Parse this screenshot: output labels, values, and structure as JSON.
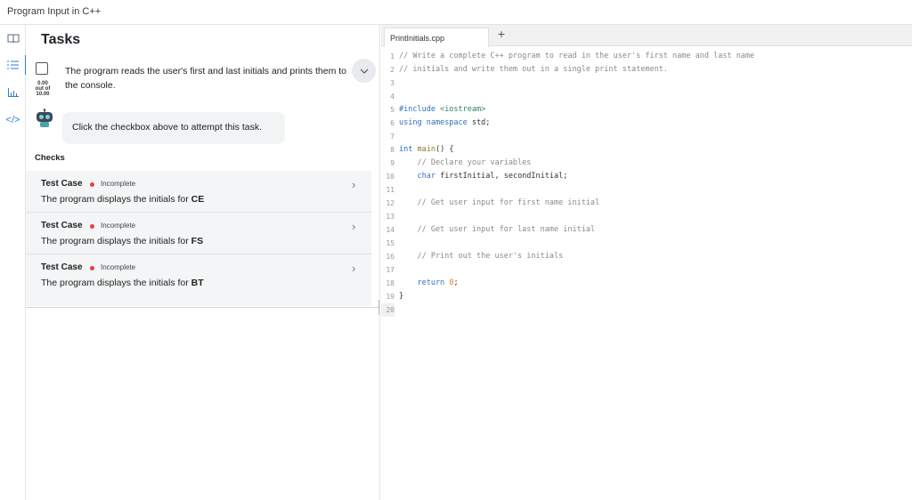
{
  "window": {
    "title": "Program Input in C++"
  },
  "rail": {
    "icons": [
      {
        "name": "book-icon",
        "glyph": "⎕"
      },
      {
        "name": "list-icon",
        "glyph": "☰"
      },
      {
        "name": "chart-icon",
        "glyph": "▥"
      },
      {
        "name": "code-icon",
        "glyph": "</>"
      }
    ]
  },
  "tasks": {
    "title": "Tasks",
    "task": {
      "text": "The program reads the user's first and last initials and prints them to the console.",
      "score_value": "0.00",
      "score_outof": "out of",
      "score_total": "10.00"
    },
    "hint": "Click the checkbox above to attempt this task.",
    "checks_label": "Checks",
    "checks": [
      {
        "case": "Test Case",
        "status": "Incomplete",
        "desc": "The program displays the initials for ",
        "initials": "CE"
      },
      {
        "case": "Test Case",
        "status": "Incomplete",
        "desc": "The program displays the initials for ",
        "initials": "FS"
      },
      {
        "case": "Test Case",
        "status": "Incomplete",
        "desc": "The program displays the initials for ",
        "initials": "BT"
      }
    ]
  },
  "editor": {
    "tab_label": "PrintInitials.cpp",
    "add_tab": "+",
    "line_numbers": [
      "1",
      "2",
      "3",
      "4",
      "5",
      "6",
      "7",
      "8",
      "9",
      "10",
      "11",
      "12",
      "13",
      "14",
      "15",
      "16",
      "17",
      "18",
      "19",
      "20"
    ],
    "code": {
      "l1": "// Write a complete C++ program to read in the user's first name and last name",
      "l2": "// initials and write them out in a single print statement.",
      "l5_pp": "#include",
      "l5_hdr": " <iostream>",
      "l6_kw1": "using",
      "l6_kw2": "namespace",
      "l6_rest": " std;",
      "l8_ty": "int",
      "l8_fn": "main",
      "l8_rest": "() {",
      "l9": "    // Declare your variables",
      "l10_ty": "    char",
      "l10_rest": " firstInitial, secondInitial;",
      "l12": "    // Get user input for first name initial",
      "l14": "    // Get user input for last name initial",
      "l16": "    // Print out the user's initials",
      "l18_kw": "    return",
      "l18_num": "0",
      "l18_end": ";",
      "l19": "}"
    }
  }
}
